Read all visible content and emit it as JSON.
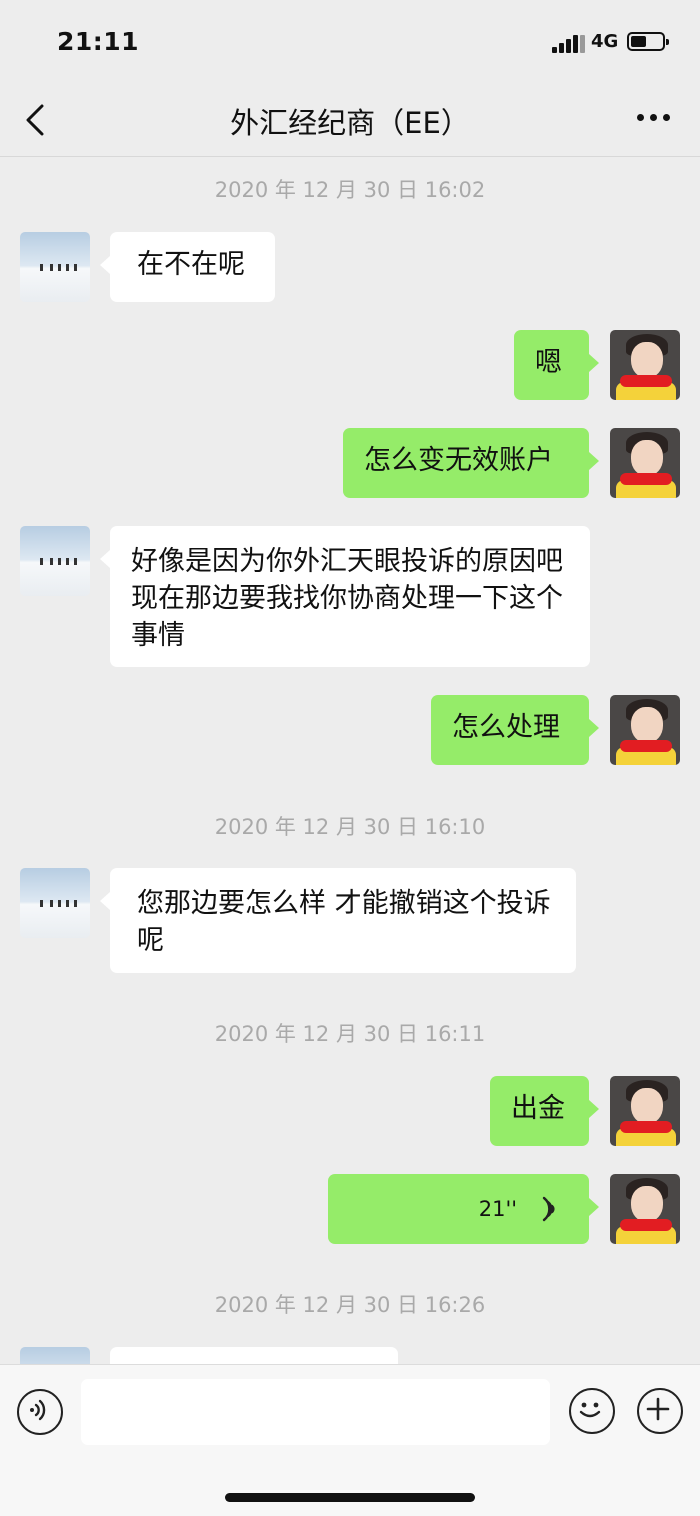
{
  "status": {
    "time": "21:11",
    "network": "4G"
  },
  "nav": {
    "title": "外汇经纪商（EE）"
  },
  "chat": {
    "timestamps": [
      "2020 年 12 月 30 日 16:02",
      "2020 年 12 月 30 日 16:10",
      "2020 年 12 月 30 日 16:11",
      "2020 年 12 月 30 日 16:26"
    ],
    "messages": [
      {
        "side": "left",
        "text": "在不在呢"
      },
      {
        "side": "right",
        "text": "嗯"
      },
      {
        "side": "right",
        "text": "怎么变无效账户"
      },
      {
        "side": "left",
        "text": "好像是因为你外汇天眼投诉的原因吧  现在那边要我找你协商处理一下这个事情"
      },
      {
        "side": "right",
        "text": "怎么处理"
      },
      {
        "side": "left",
        "text": "您那边要怎么样 才能撤销这个投诉呢"
      },
      {
        "side": "right",
        "text": "出金"
      },
      {
        "side": "right",
        "type": "voice",
        "text": "21''"
      }
    ]
  },
  "colors": {
    "background": "#ededed",
    "sent_bubble": "#95ec69",
    "received_bubble": "#ffffff"
  },
  "icons": {
    "back": "chevron-left-icon",
    "more": "ellipsis-icon",
    "voice_input": "voice-wave-icon",
    "emoji": "smile-icon",
    "plus": "plus-icon"
  }
}
